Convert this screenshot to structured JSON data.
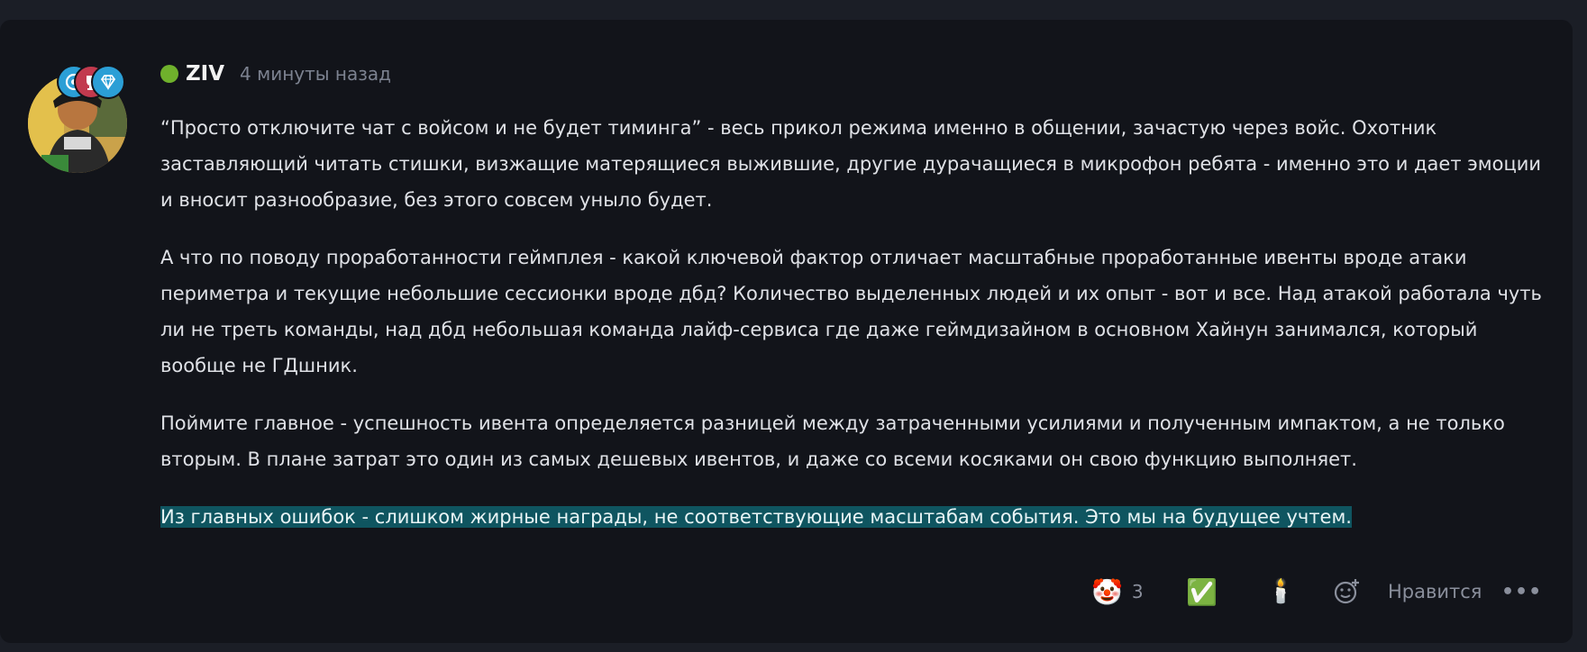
{
  "comment": {
    "author": "ZIV",
    "timestamp": "4 минуты назад",
    "online_color": "#6fb12c",
    "badges": [
      "gamepad-badge-icon",
      "trophy-badge-icon",
      "diamond-badge-icon"
    ],
    "paragraphs": [
      "“Просто отключите чат с войсом и не будет тиминга” - весь прикол режима именно в общении, зачастую через войс. Охотник заставляющий читать стишки, визжащие матерящиеся выжившие, другие дурачащиеся в микрофон ребята - именно это и дает эмоции и вносит разнообразие, без этого совсем уныло будет.",
      "А что по поводу проработанности геймплея - какой ключевой фактор отличает масштабные проработанные ивенты вроде атаки периметра и текущие небольшие сессионки вроде дбд? Количество выделенных людей и их опыт - вот и все. Над атакой работала чуть ли не треть команды, над дбд небольшая команда лайф-сервиса где даже геймдизайном в основном Хайнун занимался, который вообще не ГДшник.",
      "Поймите главное - успешность ивента определяется разницей между затраченными усилиями и полученным импактом, а не только вторым. В плане затрат это один из самых дешевых ивентов, и даже со всеми косяками он свою функцию выполняет.",
      "Из главных ошибок - слишком жирные награды, не соответствующие масштабам события. Это мы на будущее учтем."
    ],
    "reactions": [
      {
        "icon": "🤡",
        "name": "clown-reaction",
        "count": "3"
      },
      {
        "icon": "✅",
        "name": "check-reaction",
        "count": ""
      },
      {
        "icon": "🕯️",
        "name": "candle-reaction",
        "count": ""
      }
    ],
    "like_label": "Нравится",
    "more_label": "•••"
  }
}
